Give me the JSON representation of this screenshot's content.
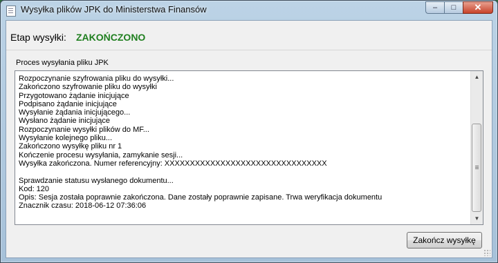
{
  "window": {
    "title": "Wysyłka plików JPK do Ministerstwa Finansów",
    "controls": {
      "minimize": "–",
      "maximize": "□",
      "close": "✕"
    }
  },
  "stage": {
    "label": "Etap wysyłki:",
    "value": "ZAKOŃCZONO",
    "value_color": "#1f7f1f"
  },
  "log_group": {
    "label": "Proces wysyłania pliku JPK",
    "lines": [
      "Rozpoczynanie szyfrowania pliku do wysyłki...",
      "Zakończono szyfrowanie pliku do wysyłki",
      "Przygotowano żądanie inicjujące",
      "Podpisano żądanie inicjujące",
      "Wysyłanie żądania inicjującego...",
      "Wysłano żądanie inicjujące",
      "Rozpoczynanie wysyłki plików do MF...",
      "Wysyłanie kolejnego pliku...",
      "Zakończono wysyłkę pliku nr 1",
      "Kończenie procesu wysyłania, zamykanie sesji...",
      "Wysyłka zakończona. Numer referencyjny: XXXXXXXXXXXXXXXXXXXXXXXXXXXXXXXX",
      "",
      "Sprawdzanie statusu wysłanego dokumentu...",
      "Kod: 120",
      "Opis: Sesja została poprawnie zakończona. Dane zostały poprawnie zapisane. Trwa weryfikacja dokumentu",
      "Znacznik czasu: 2018-06-12 07:36:06"
    ]
  },
  "scrollbar": {
    "up_arrow": "▲",
    "down_arrow": "▼"
  },
  "buttons": {
    "finish": "Zakończ wysyłkę"
  }
}
